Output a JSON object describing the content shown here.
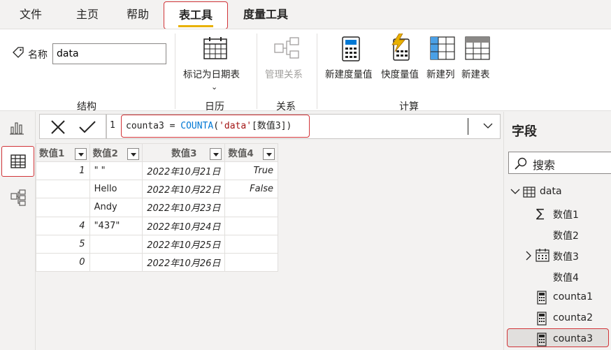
{
  "menu": {
    "file": "文件",
    "home": "主页",
    "help": "帮助",
    "table_tools": "表工具",
    "measure_tools": "度量工具"
  },
  "ribbon": {
    "name_label": "名称",
    "name_value": "data",
    "mark_date_table": "标记为日期表",
    "manage_relations": "管理关系",
    "new_measure": "新建度量值",
    "quick_measure": "快度量值",
    "new_column": "新建列",
    "new_table": "新建表",
    "groups": {
      "structure": "结构",
      "calendar": "日历",
      "relations": "关系",
      "calc": "计算"
    }
  },
  "formula": {
    "line": "1",
    "text": "counta3 = COUNTA('data'[数值3])"
  },
  "table": {
    "headers": [
      "数值1",
      "数值2",
      "数值3",
      "数值4"
    ],
    "rows": [
      [
        "1",
        "\" \"",
        "2022年10月21日",
        "True"
      ],
      [
        "",
        "Hello",
        "2022年10月22日",
        "False"
      ],
      [
        "",
        "Andy",
        "2022年10月23日",
        ""
      ],
      [
        "4",
        "\"437\"",
        "2022年10月24日",
        ""
      ],
      [
        "5",
        "",
        "2022年10月25日",
        ""
      ],
      [
        "0",
        "",
        "2022年10月26日",
        ""
      ]
    ]
  },
  "fields": {
    "title": "字段",
    "search_placeholder": "搜索",
    "table_name": "data",
    "items": [
      "数值1",
      "数值2",
      "数值3",
      "数值4",
      "counta1",
      "counta2",
      "counta3"
    ]
  },
  "colors": {
    "accent": "#e8b100",
    "highlight": "#d13438"
  }
}
